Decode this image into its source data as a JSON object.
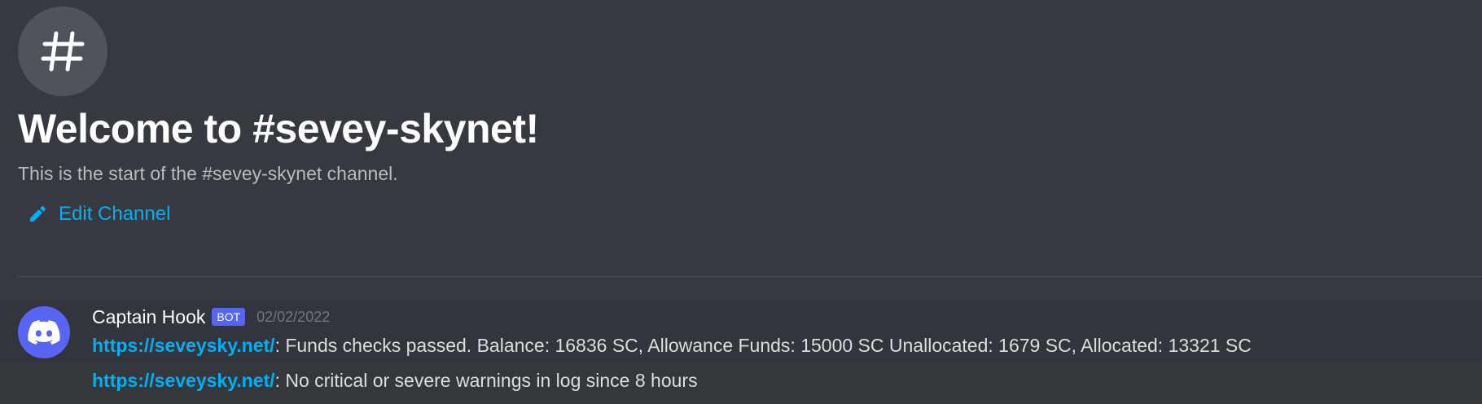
{
  "channel": {
    "icon": "hash-icon",
    "welcome_title": "Welcome to #sevey-skynet!",
    "welcome_subtitle": "This is the start of the #sevey-skynet channel.",
    "edit_label": "Edit Channel"
  },
  "messages": {
    "author": "Captain Hook",
    "badge": "BOT",
    "timestamp": "02/02/2022",
    "avatar_icon": "discord-logo-icon",
    "items": [
      {
        "link": "https://seveysky.net/",
        "text": ": Funds checks passed. Balance: 16836 SC, Allowance Funds: 15000 SC Unallocated: 1679 SC, Allocated: 13321 SC"
      },
      {
        "link": "https://seveysky.net/",
        "text": ": No critical or severe warnings in log since 8 hours"
      }
    ]
  },
  "colors": {
    "background": "#36393f",
    "link": "#00aff4",
    "brand": "#5865f2"
  }
}
